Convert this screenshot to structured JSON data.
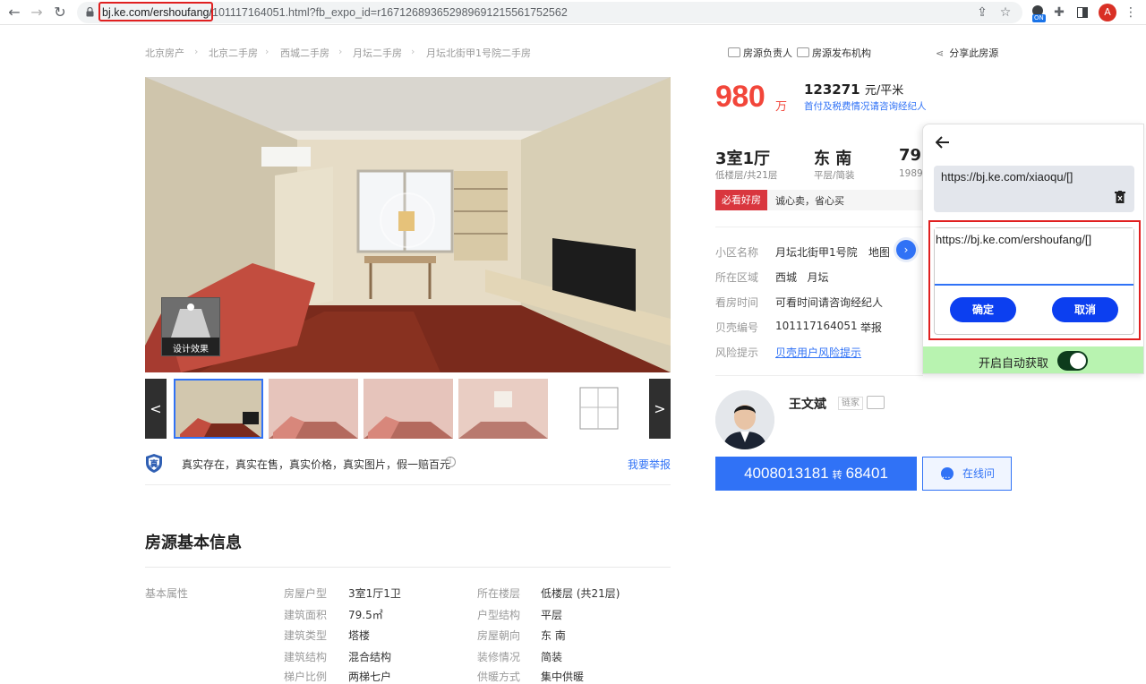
{
  "browser": {
    "url_host": "bj.ke.com/ershoufang/",
    "url_rest": "101117164051.html?fb_expo_id=r167126893652989691215561752562",
    "avatar_letter": "A",
    "ext_badge": "ON"
  },
  "breadcrumb": [
    "北京房产",
    "北京二手房",
    "西城二手房",
    "月坛二手房",
    "月坛北街甲1号院二手房"
  ],
  "top_links": {
    "owner": "房源负责人",
    "agency": "房源发布机构",
    "share": "分享此房源"
  },
  "gallery": {
    "design_label": "设计效果",
    "prev": "<",
    "next": ">"
  },
  "promise": {
    "text": "真实存在，真实在售，真实价格，真实图片，假一赔百元",
    "badge": "真",
    "report": "我要举报"
  },
  "price": {
    "total": "980",
    "total_unit": "万",
    "unit_value": "123271",
    "unit_suffix": "元/平米",
    "tax_note": "首付及税费情况请咨询经纪人"
  },
  "specs": [
    {
      "main": "3室1厅",
      "sub": "低楼层/共21层"
    },
    {
      "main": "东 南",
      "sub": "平层/简装"
    },
    {
      "main": "79",
      "sub": "1989"
    }
  ],
  "highlight": {
    "tag": "必看好房",
    "text": "诚心卖，省心买"
  },
  "info": [
    {
      "key": "小区名称",
      "value": "月坛北街甲1号院",
      "extra": "地图"
    },
    {
      "key": "所在区域",
      "value": "西城   月坛",
      "extra": ""
    },
    {
      "key": "看房时间",
      "value": "可看时间请咨询经纪人",
      "extra": ""
    },
    {
      "key": "贝壳编号",
      "value": "101117164051",
      "extra": "举报"
    },
    {
      "key": "风险提示",
      "value": "贝壳用户风险提示",
      "extra": ""
    }
  ],
  "agent": {
    "name": "王文斌",
    "brand": "链家",
    "phone": "4008013181",
    "ext_label": "转",
    "ext": "68401",
    "chat": "在线问"
  },
  "basic_info": {
    "title": "房源基本信息",
    "label": "基本属性",
    "left": [
      {
        "k": "房屋户型",
        "v": "3室1厅1卫"
      },
      {
        "k": "建筑面积",
        "v": "79.5㎡"
      },
      {
        "k": "建筑类型",
        "v": "塔楼"
      },
      {
        "k": "建筑结构",
        "v": "混合结构"
      },
      {
        "k": "梯户比例",
        "v": "两梯七户"
      }
    ],
    "right": [
      {
        "k": "所在楼层",
        "v": "低楼层 (共21层)"
      },
      {
        "k": "户型结构",
        "v": "平层"
      },
      {
        "k": "房屋朝向",
        "v": "东 南"
      },
      {
        "k": "装修情况",
        "v": "简装"
      },
      {
        "k": "供暖方式",
        "v": "集中供暖"
      }
    ]
  },
  "popup": {
    "saved_url": "https://bj.ke.com/xiaoqu/[]",
    "edit_value": "https://bj.ke.com/ershoufang/[]",
    "confirm": "确定",
    "cancel": "取消",
    "auto_label": "开启自动获取",
    "auto_on": true
  }
}
